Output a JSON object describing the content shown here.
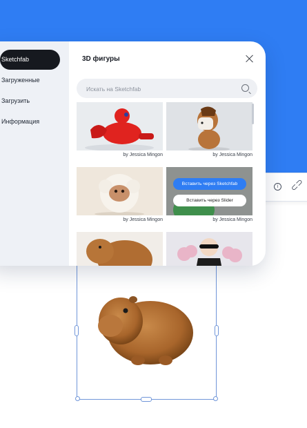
{
  "modal": {
    "title": "3D фигуры",
    "search_placeholder": "Искать на Sketchfab"
  },
  "sidebar": {
    "items": [
      {
        "label": "Sketchfab",
        "active": true
      },
      {
        "label": "Загруженные",
        "active": false
      },
      {
        "label": "Загрузить",
        "active": false
      },
      {
        "label": "Информация",
        "active": false
      }
    ]
  },
  "cards": [
    {
      "credit": "by Jessica Mingon",
      "subject": "red-dragon"
    },
    {
      "credit": "by Jessica Mingon",
      "subject": "horse"
    },
    {
      "credit": "by Jessica Mingon",
      "subject": "sheep"
    },
    {
      "credit": "by Jessica Mingon",
      "subject": "green-figure"
    },
    {
      "credit": "",
      "subject": "capybara"
    },
    {
      "credit": "",
      "subject": "girl-with-clouds"
    }
  ],
  "card_overlay": {
    "primary_label": "Вставить через Sketchfab",
    "secondary_label": "Вставить через Slider"
  },
  "toolbar_icons": [
    "info-icon",
    "link-icon"
  ],
  "colors": {
    "accent": "#2f7df3",
    "background_blue": "#2f7df3",
    "sidebar_active": "#16191f"
  }
}
